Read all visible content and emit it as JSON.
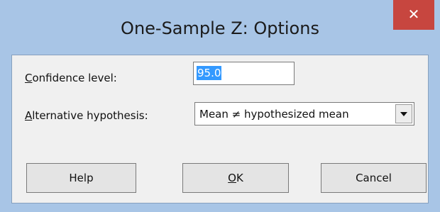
{
  "window": {
    "title": "One-Sample Z: Options",
    "close_glyph": "✕"
  },
  "form": {
    "confidence_label_first": "C",
    "confidence_label_rest": "onfidence level:",
    "confidence_value": "95.0",
    "alternative_label_first": "A",
    "alternative_label_rest": "lternative hypothesis:",
    "alternative_value": "Mean ≠ hypothesized mean"
  },
  "buttons": {
    "help": "Help",
    "ok_first": "O",
    "ok_rest": "K",
    "cancel": "Cancel"
  },
  "colors": {
    "frame": "#a8c5e6",
    "close_button": "#c7463f",
    "selection": "#3399ff"
  },
  "icons": [
    "close-icon",
    "chevron-down-icon"
  ]
}
